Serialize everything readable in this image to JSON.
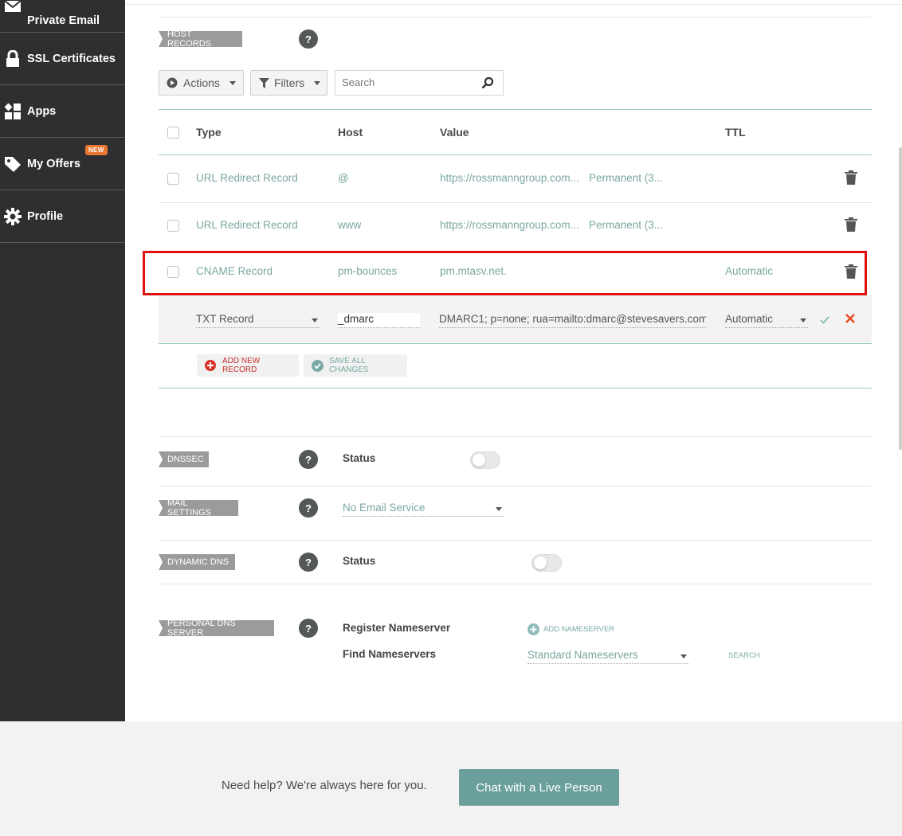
{
  "sidebar": {
    "items": [
      {
        "label": "Private Email",
        "icon": "envelope-icon"
      },
      {
        "label": "SSL Certificates",
        "icon": "lock-icon"
      },
      {
        "label": "Apps",
        "icon": "apps-grid-icon"
      },
      {
        "label": "My Offers",
        "icon": "tag-icon",
        "badge": "NEW"
      },
      {
        "label": "Profile",
        "icon": "gear-icon"
      }
    ]
  },
  "host_records": {
    "tag": "HOST RECORDS",
    "help": "?",
    "actions_label": "Actions",
    "filters_label": "Filters",
    "search_placeholder": "Search",
    "columns": {
      "type": "Type",
      "host": "Host",
      "value": "Value",
      "ttl": "TTL"
    },
    "rows": [
      {
        "type": "URL Redirect Record",
        "host": "@",
        "value": "https://rossmanngroup.com...",
        "extra": "Permanent (3...",
        "ttl": ""
      },
      {
        "type": "URL Redirect Record",
        "host": "www",
        "value": "https://rossmanngroup.com...",
        "extra": "Permanent (3...",
        "ttl": ""
      },
      {
        "type": "CNAME Record",
        "host": "pm-bounces",
        "value": "pm.mtasv.net.",
        "extra": "",
        "ttl": "Automatic"
      }
    ],
    "edit_row": {
      "type": "TXT Record",
      "host": "_dmarc",
      "value": "DMARC1; p=none; rua=mailto:dmarc@stevesavers.com",
      "ttl": "Automatic"
    },
    "add_new_record": "ADD NEW RECORD",
    "save_all_changes": "SAVE ALL CHANGES"
  },
  "dnssec": {
    "tag": "DNSSEC",
    "status_label": "Status"
  },
  "mail_settings": {
    "tag": "MAIL SETTINGS",
    "selected": "No Email Service"
  },
  "dynamic_dns": {
    "tag": "DYNAMIC DNS",
    "status_label": "Status"
  },
  "personal_dns": {
    "tag": "PERSONAL DNS SERVER",
    "register_label": "Register Nameserver",
    "add_nameserver": "ADD NAMESERVER",
    "find_label": "Find Nameservers",
    "find_selected": "Standard Nameservers",
    "search_label": "SEARCH"
  },
  "footer": {
    "help_text": "Need help? We're always here for you.",
    "chat_button": "Chat with a Live Person"
  },
  "colors": {
    "sidebar_bg": "#2d2f30",
    "accent_teal": "#6a9f9b",
    "highlight_red": "#e01010",
    "badge_orange": "#e97732"
  }
}
